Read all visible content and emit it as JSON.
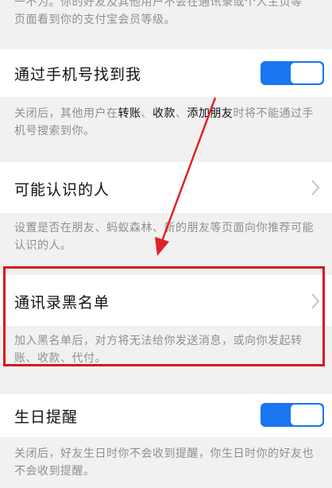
{
  "top_desc": {
    "line1": "一不为。你的好友及其他用户不会在通讯录或个人主页等",
    "line2": "页面看到你的支付宝会员等级。"
  },
  "find_by_phone": {
    "label": "通过手机号找到我",
    "toggle_on": true,
    "desc_a": "关闭后，其他用户在",
    "desc_k1": "转账",
    "desc_s1": "、",
    "desc_k2": "收款",
    "desc_s2": "、",
    "desc_k3": "添加朋友",
    "desc_b": "时将不能通过手机号搜索到你。"
  },
  "people_you_may_know": {
    "label": "可能认识的人",
    "desc": "设置是否在朋友、蚂蚁森林、新的朋友等页面向你推荐可能认识的人。"
  },
  "blacklist": {
    "label": "通讯录黑名单",
    "desc": "加入黑名单后，对方将无法给你发送消息，或向你发起转账、收款、代付。"
  },
  "birthday_reminder": {
    "label": "生日提醒",
    "toggle_on": true,
    "desc": "关闭后，好友生日时你不会收到提醒，你生日时你的好友也不会收到提醒。"
  },
  "colors": {
    "toggle": "#1976f0",
    "highlight_box": "#d8141e",
    "arrow": "#e0202a"
  }
}
